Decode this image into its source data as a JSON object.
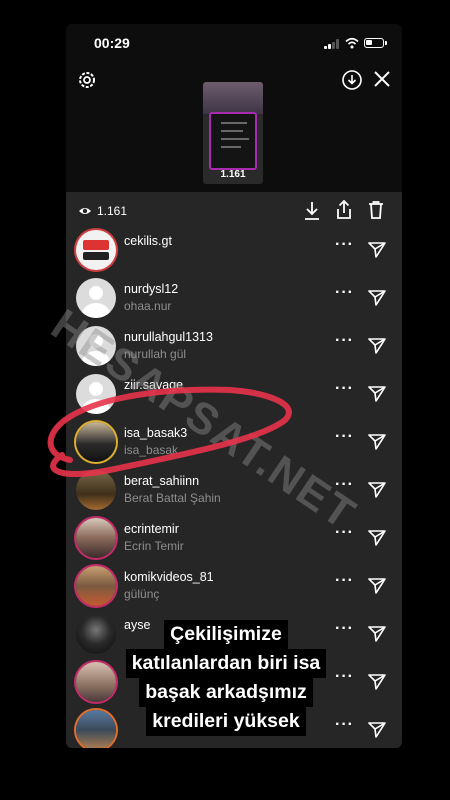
{
  "status_bar": {
    "time": "00:29"
  },
  "story": {
    "thumb_count": "1.161"
  },
  "sheet": {
    "views_count": "1.161",
    "viewers": [
      {
        "username": "cekilis.gt",
        "fullname": "",
        "avatar": "badge"
      },
      {
        "username": "nurdysl12",
        "fullname": "ohaa.nur",
        "avatar": "default"
      },
      {
        "username": "nurullahgul1313",
        "fullname": "nurullah gül",
        "avatar": "default"
      },
      {
        "username": "ziir.savage",
        "fullname": "",
        "avatar": "default"
      },
      {
        "username": "isa_basak3",
        "fullname": "isa_basak",
        "avatar": "photo"
      },
      {
        "username": "berat_sahiinn",
        "fullname": "Berat Battal Şahin",
        "avatar": "photo"
      },
      {
        "username": "ecrintemir",
        "fullname": "Ecrin Temir",
        "avatar": "photo"
      },
      {
        "username": "komikvideos_81",
        "fullname": "gülünç",
        "avatar": "photo"
      },
      {
        "username": "ayse",
        "fullname": "",
        "avatar": "photo"
      },
      {
        "username": "",
        "fullname": "",
        "avatar": "photo"
      },
      {
        "username": "",
        "fullname": "",
        "avatar": "photo"
      }
    ]
  },
  "watermark": {
    "text": "HESAPSAT.NET"
  },
  "caption": {
    "lines": [
      "Çekilişimize",
      "katılanlardan biri isa",
      "başak arkadşımız",
      "kredileri yüksek"
    ]
  },
  "colors": {
    "sheet_bg": "#262626",
    "ring": "#c62b6b",
    "scribble": "#e8334a"
  }
}
